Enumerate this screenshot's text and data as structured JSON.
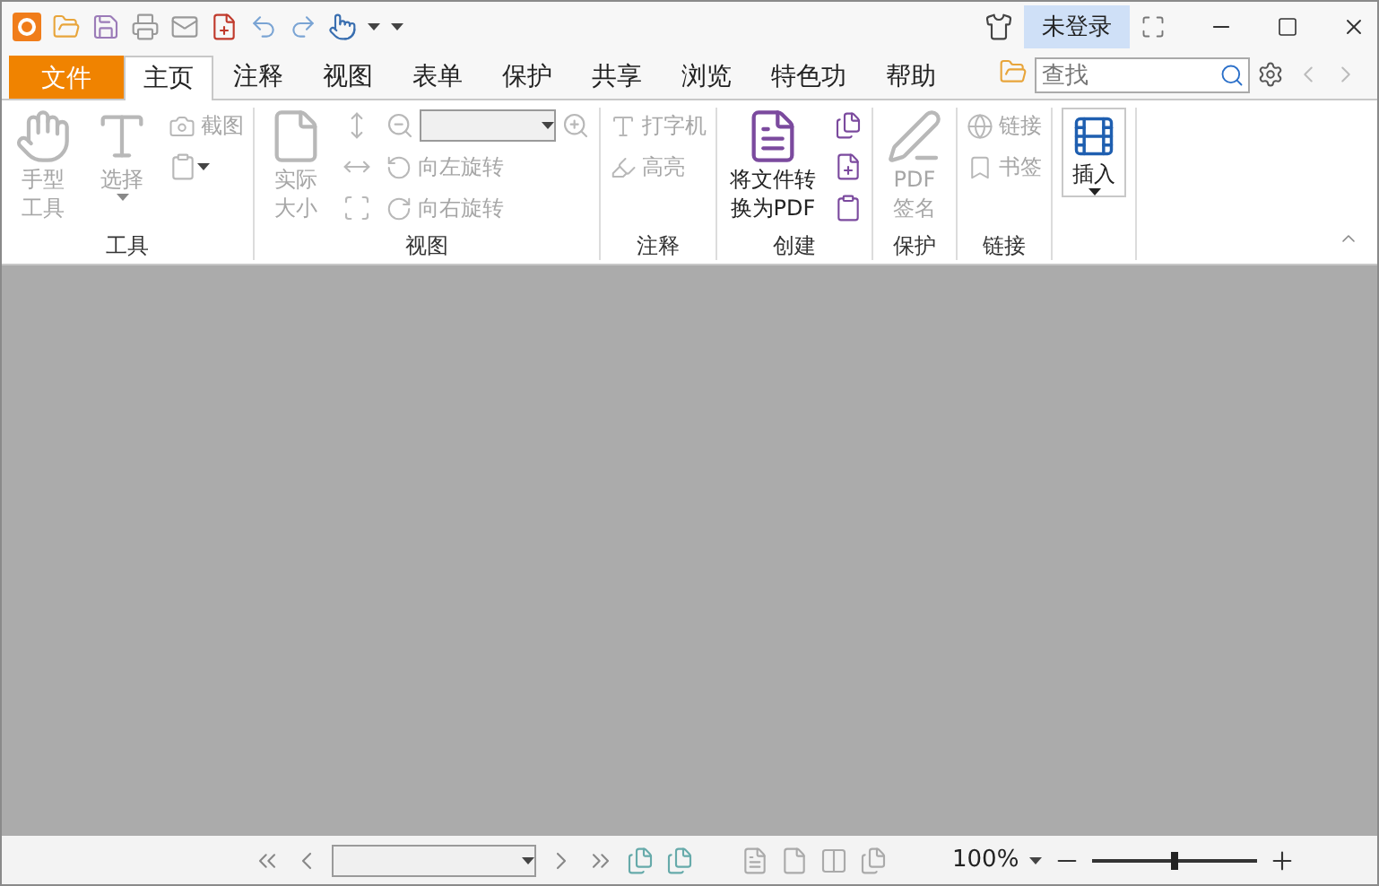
{
  "title_bar": {
    "account_button": "未登录"
  },
  "menu_tabs": [
    {
      "label": "文件",
      "kind": "file",
      "selected": false
    },
    {
      "label": "主页",
      "kind": "tab",
      "selected": true
    },
    {
      "label": "注释",
      "kind": "tab",
      "selected": false
    },
    {
      "label": "视图",
      "kind": "tab",
      "selected": false
    },
    {
      "label": "表单",
      "kind": "tab",
      "selected": false
    },
    {
      "label": "保护",
      "kind": "tab",
      "selected": false
    },
    {
      "label": "共享",
      "kind": "tab",
      "selected": false
    },
    {
      "label": "浏览",
      "kind": "tab",
      "selected": false
    },
    {
      "label": "特色功",
      "kind": "tab",
      "selected": false
    },
    {
      "label": "帮助",
      "kind": "tab",
      "selected": false
    }
  ],
  "search": {
    "placeholder": "查找"
  },
  "ribbon_groups": [
    {
      "label": "工具",
      "columns": [
        [
          {
            "kind": "large",
            "lines": [
              "手型",
              "工具"
            ],
            "disabled": true
          }
        ],
        [
          {
            "kind": "large",
            "lines": [
              "选择"
            ],
            "disabled": true,
            "dropdown": true
          }
        ],
        [
          {
            "kind": "small",
            "label": "截图",
            "disabled": true
          },
          {
            "kind": "icon",
            "disabled": true,
            "dropdown": true
          }
        ]
      ]
    },
    {
      "label": "视图",
      "columns": [
        [
          {
            "kind": "large",
            "lines": [
              "实际",
              "大小"
            ],
            "disabled": true
          }
        ],
        [
          {
            "kind": "icon",
            "disabled": true
          },
          {
            "kind": "icon",
            "disabled": true
          },
          {
            "kind": "icon",
            "disabled": true
          }
        ],
        [
          {
            "kind": "combo",
            "disabled": true
          },
          {
            "kind": "small",
            "label": "向左旋转",
            "disabled": true
          },
          {
            "kind": "small",
            "label": "向右旋转",
            "disabled": true
          }
        ]
      ]
    },
    {
      "label": "注释",
      "columns": [
        [
          {
            "kind": "small",
            "label": "打字机",
            "disabled": true
          },
          {
            "kind": "small",
            "label": "高亮",
            "disabled": true
          }
        ]
      ]
    },
    {
      "label": "创建",
      "columns": [
        [
          {
            "kind": "large",
            "lines": [
              "将文件转",
              "换为PDF"
            ],
            "disabled": false
          }
        ],
        [
          {
            "kind": "icon",
            "disabled": false
          },
          {
            "kind": "icon",
            "disabled": false
          },
          {
            "kind": "icon",
            "disabled": false
          }
        ]
      ]
    },
    {
      "label": "保护",
      "columns": [
        [
          {
            "kind": "large",
            "lines": [
              "PDF",
              "签名"
            ],
            "disabled": true
          }
        ]
      ]
    },
    {
      "label": "链接",
      "columns": [
        [
          {
            "kind": "small",
            "label": "链接",
            "disabled": true
          },
          {
            "kind": "small",
            "label": "书签",
            "disabled": true
          }
        ]
      ]
    },
    {
      "columns": [
        [
          {
            "kind": "boxed",
            "lines": [
              "插入"
            ],
            "disabled": false,
            "dropdown": true
          }
        ]
      ]
    }
  ],
  "status_bar": {
    "zoom": "100%",
    "zoom_slider": {
      "level": 0.5
    }
  }
}
